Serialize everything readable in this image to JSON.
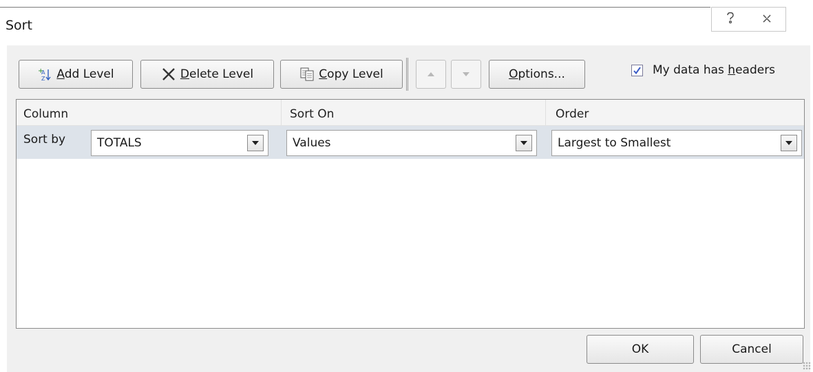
{
  "dialog": {
    "title": "Sort",
    "help_icon": "question-icon",
    "close_icon": "close-icon"
  },
  "toolbar": {
    "add_level": {
      "prefix": "",
      "accel": "A",
      "rest": "dd Level",
      "icon": "add-sort-icon"
    },
    "delete_level": {
      "accel": "D",
      "rest": "elete Level",
      "icon": "x-icon"
    },
    "copy_level": {
      "accel": "C",
      "rest": "opy Level",
      "icon": "copy-icon"
    },
    "move_up": {
      "icon": "up-arrow-icon"
    },
    "move_down": {
      "icon": "down-arrow-icon"
    },
    "options": {
      "accel": "O",
      "rest": "ptions..."
    },
    "headers": {
      "pre": "My data has ",
      "accel": "h",
      "rest": "eaders",
      "checked": true
    }
  },
  "grid": {
    "headers": {
      "column": "Column",
      "sort_on": "Sort On",
      "order": "Order"
    },
    "rows": [
      {
        "label": "Sort by",
        "column": "TOTALS",
        "sort_on": "Values",
        "order": "Largest to Smallest"
      }
    ]
  },
  "footer": {
    "ok": "OK",
    "cancel": "Cancel"
  },
  "colors": {
    "row_selected": "#dde3ea",
    "check_mark": "#3b5cc7"
  }
}
